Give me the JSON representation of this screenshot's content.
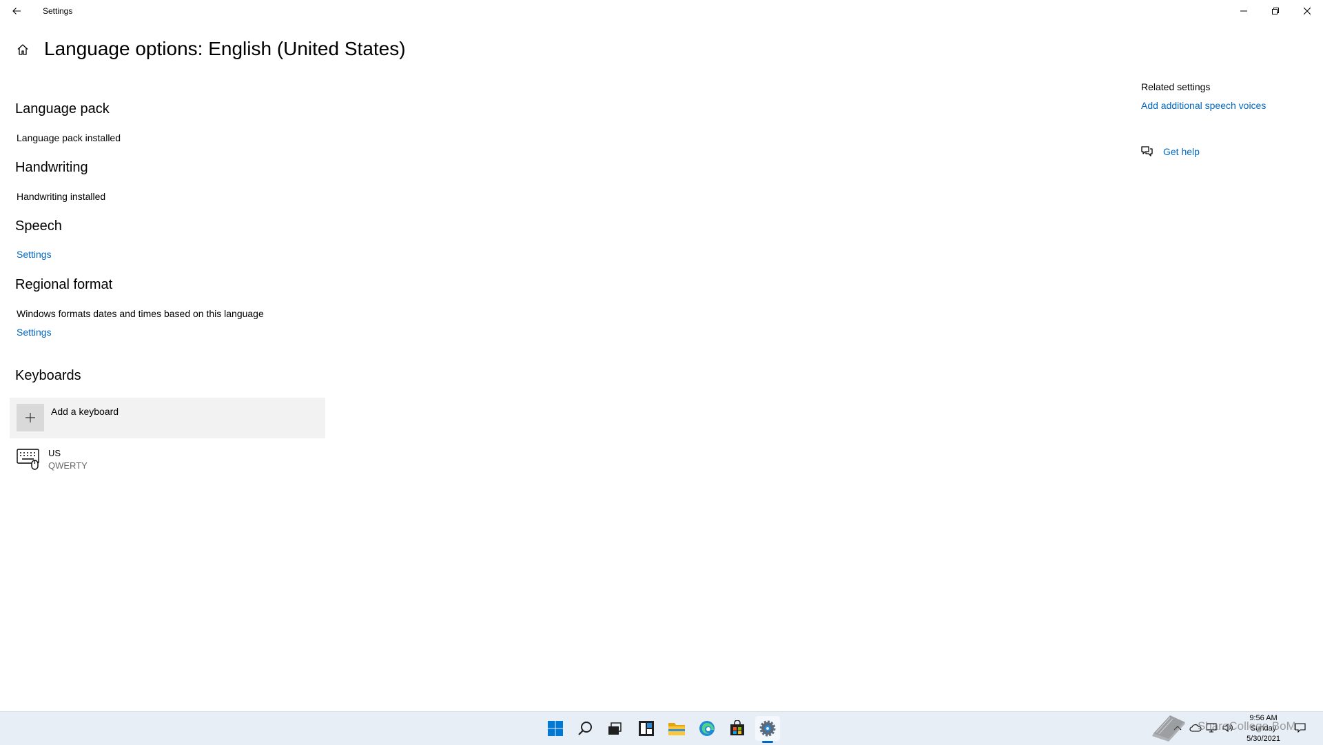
{
  "window": {
    "title": "Settings",
    "back_label": "Back",
    "minimize_label": "Minimize",
    "restore_label": "Restore",
    "close_label": "Close"
  },
  "page": {
    "title": "Language options: English (United States)"
  },
  "sections": {
    "language_pack": {
      "heading": "Language pack",
      "status": "Language pack installed"
    },
    "handwriting": {
      "heading": "Handwriting",
      "status": "Handwriting installed"
    },
    "speech": {
      "heading": "Speech",
      "settings_link": "Settings"
    },
    "regional_format": {
      "heading": "Regional format",
      "description": "Windows formats dates and times based on this language",
      "settings_link": "Settings"
    },
    "keyboards": {
      "heading": "Keyboards",
      "add_label": "Add a keyboard",
      "items": [
        {
          "name": "US",
          "layout": "QWERTY"
        }
      ]
    }
  },
  "related": {
    "heading": "Related settings",
    "link": "Add additional speech voices",
    "help_label": "Get help"
  },
  "taskbar": {
    "icons": [
      "start-icon",
      "search-icon",
      "task-view-icon",
      "widgets-icon",
      "file-explorer-icon",
      "edge-icon",
      "store-icon",
      "settings-icon"
    ],
    "active_app": "settings-icon",
    "time": "9:56 AM",
    "day": "Sunday",
    "date": "5/30/2021"
  },
  "watermark": {
    "text": "ShareCollege BoM"
  },
  "colors": {
    "accent": "#0067c0",
    "taskbar": "#e8eef6",
    "add_keyboard_bg": "#f2f2f2"
  }
}
